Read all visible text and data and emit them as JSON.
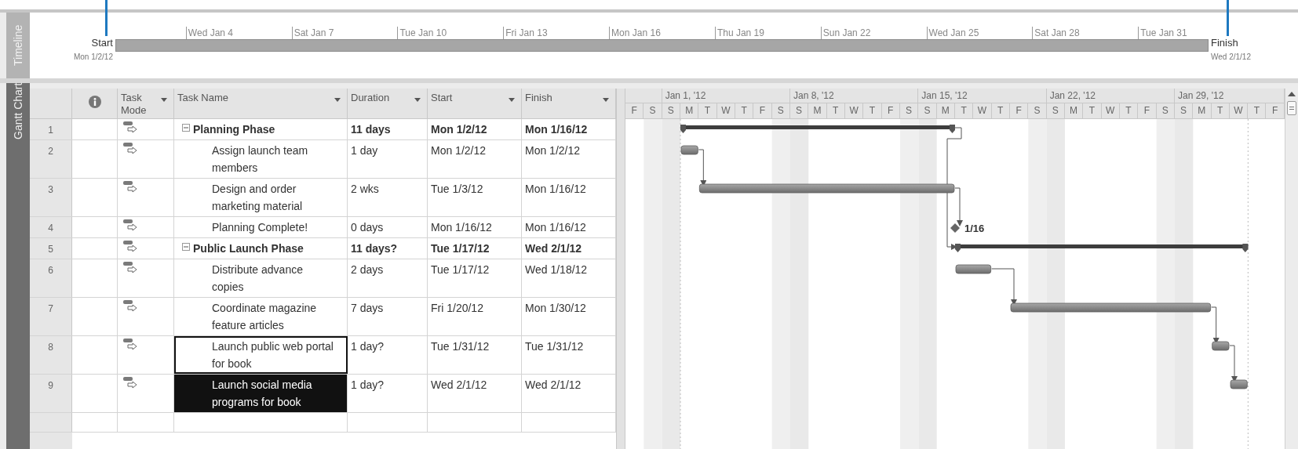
{
  "timeline": {
    "tab": "Timeline",
    "start_label": "Start",
    "start_date": "Mon 1/2/12",
    "finish_label": "Finish",
    "finish_date": "Wed 2/1/12",
    "ticks": [
      "Wed Jan 4",
      "Sat Jan 7",
      "Tue Jan 10",
      "Fri Jan 13",
      "Mon Jan 16",
      "Thu Jan 19",
      "Sun Jan 22",
      "Wed Jan 25",
      "Sat Jan 28",
      "Tue Jan 31"
    ]
  },
  "view_tab": "Gantt Chart",
  "table": {
    "columns": [
      {
        "label": "Task Mode"
      },
      {
        "label": "Task Name"
      },
      {
        "label": "Duration"
      },
      {
        "label": "Start"
      },
      {
        "label": "Finish"
      }
    ]
  },
  "tasks": [
    {
      "id": "1",
      "name": "Planning Phase",
      "duration": "11 days",
      "start": "Mon 1/2/12",
      "finish": "Mon 1/16/12",
      "kind": "summary",
      "expanded": true,
      "selected": false,
      "focused": false
    },
    {
      "id": "2",
      "name": "Assign launch team members",
      "duration": "1 day",
      "start": "Mon 1/2/12",
      "finish": "Mon 1/2/12",
      "kind": "task",
      "selected": false,
      "focused": false
    },
    {
      "id": "3",
      "name": "Design and order marketing material",
      "duration": "2 wks",
      "start": "Tue 1/3/12",
      "finish": "Mon 1/16/12",
      "kind": "task",
      "selected": false,
      "focused": false
    },
    {
      "id": "4",
      "name": "Planning Complete!",
      "duration": "0 days",
      "start": "Mon 1/16/12",
      "finish": "Mon 1/16/12",
      "kind": "milestone",
      "bar_label": "1/16",
      "selected": false,
      "focused": false
    },
    {
      "id": "5",
      "name": "Public Launch Phase",
      "duration": "11 days?",
      "start": "Tue 1/17/12",
      "finish": "Wed 2/1/12",
      "kind": "summary",
      "expanded": true,
      "selected": false,
      "focused": false
    },
    {
      "id": "6",
      "name": "Distribute advance copies",
      "duration": "2 days",
      "start": "Tue 1/17/12",
      "finish": "Wed 1/18/12",
      "kind": "task",
      "selected": false,
      "focused": false
    },
    {
      "id": "7",
      "name": "Coordinate magazine feature articles",
      "duration": "7 days",
      "start": "Fri 1/20/12",
      "finish": "Mon 1/30/12",
      "kind": "task",
      "selected": false,
      "focused": false
    },
    {
      "id": "8",
      "name": "Launch public web portal for book",
      "duration": "1 day?",
      "start": "Tue 1/31/12",
      "finish": "Tue 1/31/12",
      "kind": "task",
      "selected": false,
      "focused": true
    },
    {
      "id": "9",
      "name": "Launch social media programs for book",
      "duration": "1 day?",
      "start": "Wed 2/1/12",
      "finish": "Wed 2/1/12",
      "kind": "task",
      "selected": true,
      "focused": false
    }
  ],
  "gantt": {
    "weeks": [
      "Jan 1, '12",
      "Jan 8, '12",
      "Jan 15, '12",
      "Jan 22, '12",
      "Jan 29, '12"
    ],
    "days": [
      "F",
      "S",
      "S",
      "M",
      "T",
      "W",
      "T",
      "F",
      "S",
      "S",
      "M",
      "T",
      "W",
      "T",
      "F",
      "S",
      "S",
      "M",
      "T",
      "W",
      "T",
      "F",
      "S",
      "S",
      "M",
      "T",
      "W",
      "T",
      "F",
      "S",
      "S",
      "M",
      "T",
      "W",
      "T",
      "F"
    ]
  }
}
